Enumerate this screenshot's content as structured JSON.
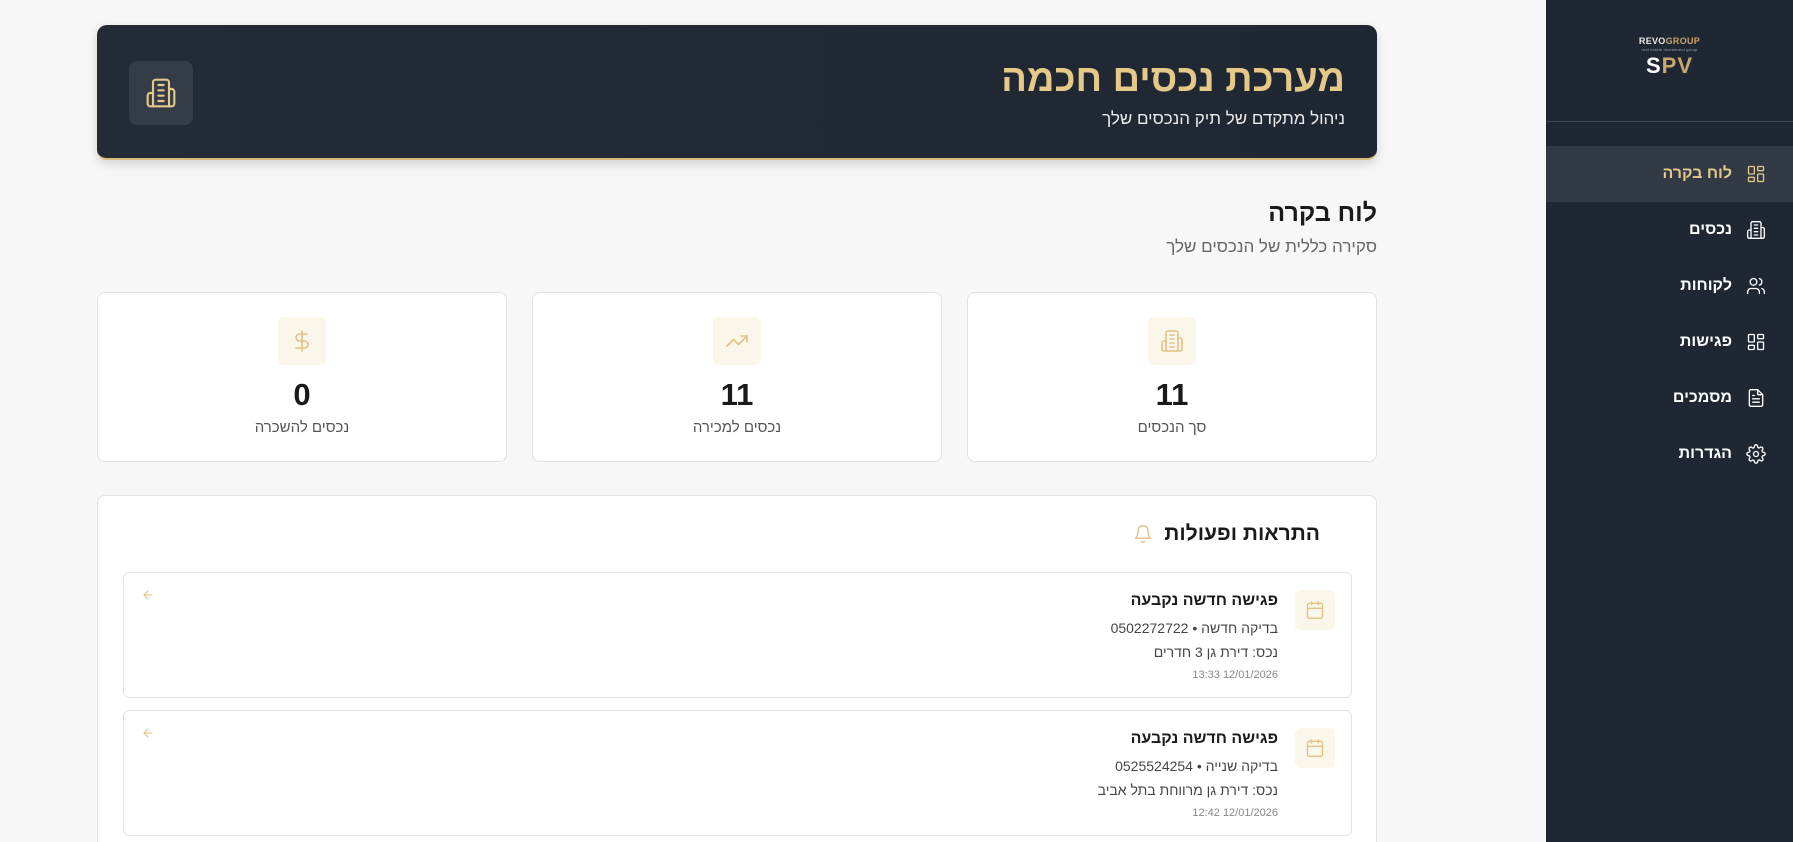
{
  "sidebar": {
    "logo": {
      "top_left": "REVO",
      "top_right": "GROUP",
      "tagline": "real estate investment group",
      "main_s": "S",
      "main_pv": "PV"
    },
    "items": [
      {
        "label": "לוח בקרה",
        "icon": "dashboard-icon",
        "active": true
      },
      {
        "label": "נכסים",
        "icon": "building-icon",
        "active": false
      },
      {
        "label": "לקוחות",
        "icon": "users-icon",
        "active": false
      },
      {
        "label": "פגישות",
        "icon": "grid-icon",
        "active": false
      },
      {
        "label": "מסמכים",
        "icon": "document-icon",
        "active": false
      },
      {
        "label": "הגדרות",
        "icon": "gear-icon",
        "active": false
      }
    ]
  },
  "hero": {
    "title": "מערכת נכסים חכמה",
    "subtitle": "ניהול מתקדם של תיק הנכסים שלך",
    "icon": "building-icon"
  },
  "dashboard": {
    "title": "לוח בקרה",
    "subtitle": "סקירה כללית של הנכסים שלך"
  },
  "stats": [
    {
      "value": "11",
      "label": "סך הנכסים",
      "icon": "building-icon"
    },
    {
      "value": "11",
      "label": "נכסים למכירה",
      "icon": "trending-up-icon"
    },
    {
      "value": "0",
      "label": "נכסים להשכרה",
      "icon": "dollar-icon"
    }
  ],
  "alerts": {
    "title": "התראות ופעולות",
    "items": [
      {
        "title": "פגישה חדשה נקבעה",
        "line1": "בדיקה חדשה • 0502272722",
        "line2": "נכס: דירת גן 3 חדרים",
        "time": "12/01/2026 13:33"
      },
      {
        "title": "פגישה חדשה נקבעה",
        "line1": "בדיקה שנייה • 0525524254",
        "line2": "נכס: דירת גן מרווחת בתל אביב",
        "time": "12/01/2026 12:42"
      }
    ]
  },
  "colors": {
    "accent": "#e6c889",
    "sidebar_bg": "#1f2733",
    "page_bg": "#f7f7f7"
  }
}
